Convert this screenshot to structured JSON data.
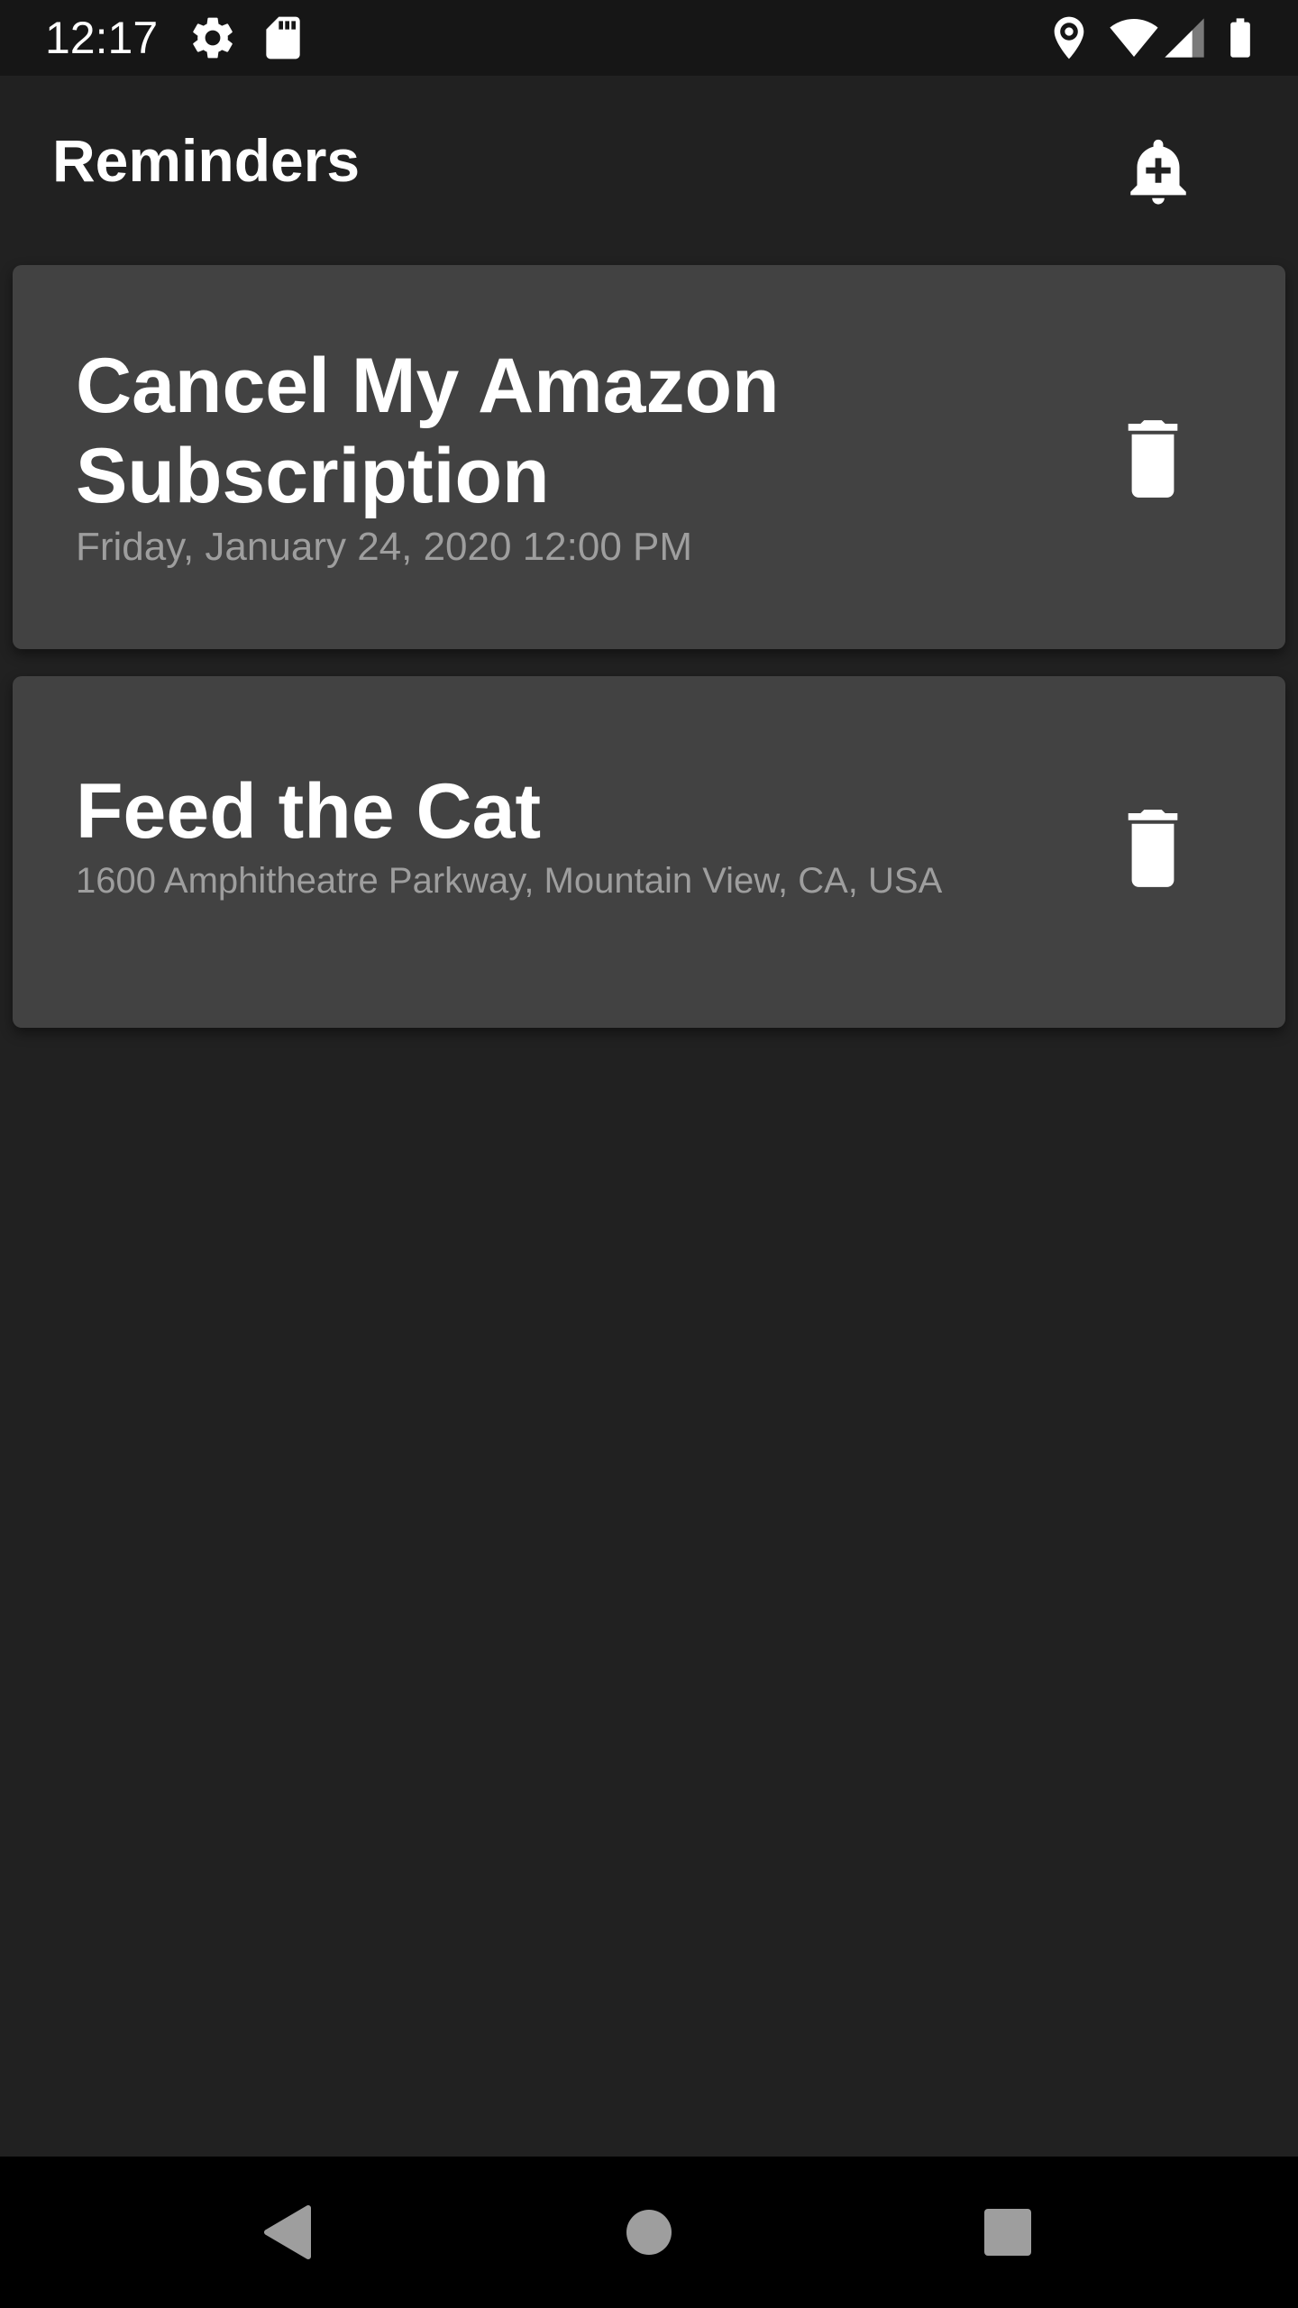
{
  "status_bar": {
    "time": "12:17",
    "left_icons": [
      "gear-icon",
      "sd-card-icon"
    ],
    "right_icons": [
      "location-icon",
      "wifi-icon",
      "cell-signal-icon",
      "battery-icon"
    ]
  },
  "app_bar": {
    "title": "Reminders",
    "add_icon": "add-alert-icon"
  },
  "reminders": [
    {
      "title": "Cancel My Amazon Subscription",
      "subtitle": "Friday, January 24, 2020 12:00 PM",
      "delete_icon": "trash-icon"
    },
    {
      "title": "Feed the Cat",
      "subtitle": "1600 Amphitheatre Parkway, Mountain View, CA, USA",
      "delete_icon": "trash-icon"
    }
  ],
  "nav_bar": {
    "buttons": [
      "back-icon",
      "home-icon",
      "recents-icon"
    ]
  },
  "colors": {
    "background": "#212121",
    "status_bar": "#161616",
    "card": "#424242",
    "subtitle": "#9e9e9e",
    "nav_bar": "#000000",
    "nav_icons": "#9e9e9e"
  }
}
